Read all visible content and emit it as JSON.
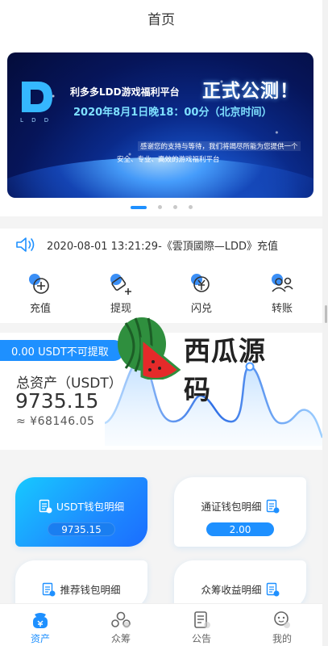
{
  "header": {
    "title": "首页"
  },
  "banner": {
    "logo_sub": "L D D",
    "title": "利多多LDD游戏福利平台",
    "headline": "正式公测！",
    "date": "2020年8月1日晚18：00分（北京时间）",
    "line1": "感谢您的支持与等待，我们将竭尽所能为您提供一个",
    "line2": "安全、专业、高效的游戏福利平台"
  },
  "carousel": {
    "count": 4,
    "active": 0
  },
  "notice": {
    "text": "2020-08-01 13:21:29-《雲頂國際—LDD》充值"
  },
  "actions": [
    {
      "label": "充值",
      "icon": "recharge-icon"
    },
    {
      "label": "提现",
      "icon": "withdraw-icon"
    },
    {
      "label": "闪兑",
      "icon": "exchange-icon"
    },
    {
      "label": "转账",
      "icon": "transfer-icon"
    }
  ],
  "assets": {
    "tag": "0.00 USDT不可提取",
    "label": "总资产（USDT）",
    "value": "9735.15",
    "cny": "≈ ¥68146.05"
  },
  "watermark": {
    "text": "西瓜源码"
  },
  "cards": [
    {
      "title": "USDT钱包明细",
      "value": "9735.15"
    },
    {
      "title": "通证钱包明细",
      "value": "2.00"
    },
    {
      "title": "推荐钱包明细"
    },
    {
      "title": "众筹收益明细"
    }
  ],
  "tabs": [
    {
      "label": "资产",
      "icon": "wallet-icon",
      "active": true
    },
    {
      "label": "众筹",
      "icon": "crowdfund-icon",
      "active": false
    },
    {
      "label": "公告",
      "icon": "announcement-icon",
      "active": false
    },
    {
      "label": "我的",
      "icon": "profile-icon",
      "active": false
    }
  ],
  "colors": {
    "accent": "#1e90ff",
    "card_gradient_start": "#17c9ff",
    "card_gradient_end": "#1a6dff"
  }
}
